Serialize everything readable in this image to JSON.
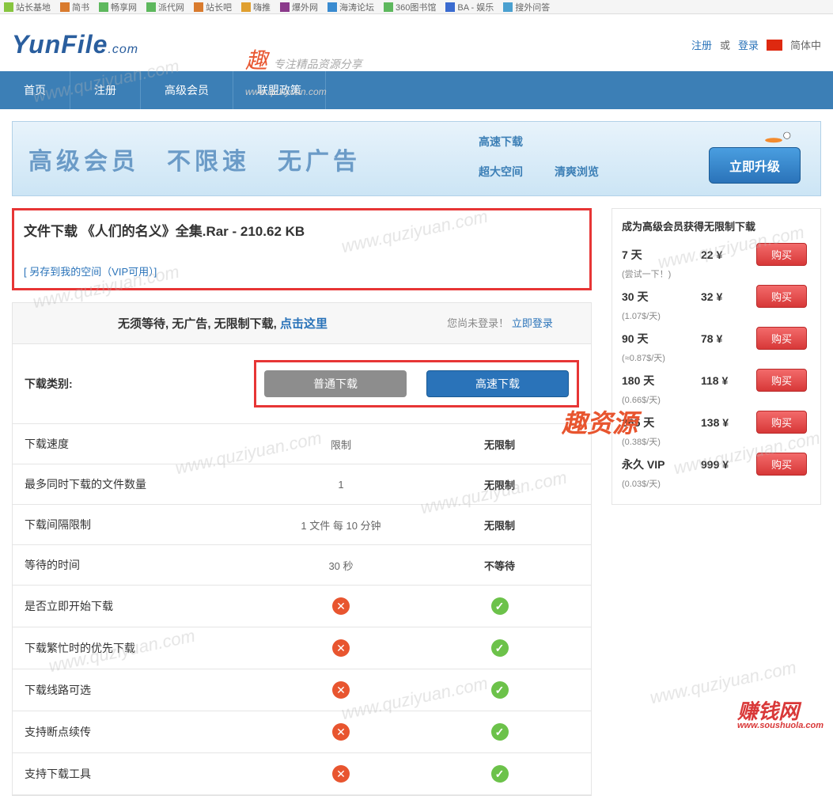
{
  "topbar": [
    "站长基地",
    "简书",
    "畅享网",
    "派代网",
    "站长吧",
    "嗨推",
    "爆外网",
    "海涛论坛",
    "360图书馆",
    "BA - 娱乐",
    "搜外问答"
  ],
  "logo": {
    "main": "YunFile",
    "ext": ".com"
  },
  "headerLinks": {
    "register": "注册",
    "or": "或",
    "login": "登录",
    "lang": "简体中"
  },
  "nav": [
    "首页",
    "注册",
    "高级会员",
    "联盟政策"
  ],
  "banner": {
    "text": "高级会员　不限速　无广告",
    "links": {
      "r1a": "高速下载",
      "r2a": "超大空间",
      "r2b": "清爽浏览"
    },
    "upgrade": "立即升级"
  },
  "fileBox": {
    "title": "文件下载 《人们的名义》全集.Rar - 210.62 KB",
    "save": "[ 另存到我的空间（VIP可用）]"
  },
  "compareHead": {
    "left_prefix": "无须等待, 无广告, 无限制下载, ",
    "left_link": "点击这里",
    "right_prefix": "您尚未登录！",
    "right_link": "立即登录"
  },
  "btnRow": {
    "label": "下载类别:",
    "normal": "普通下载",
    "fast": "高速下载"
  },
  "rows": [
    {
      "label": "下载速度",
      "c2": "限制",
      "c3": "无限制",
      "type": "text"
    },
    {
      "label": "最多同时下载的文件数量",
      "c2": "1",
      "c3": "无限制",
      "type": "text"
    },
    {
      "label": "下载间隔限制",
      "c2": "1 文件 每 10 分钟",
      "c3": "无限制",
      "type": "text"
    },
    {
      "label": "等待的时间",
      "c2": "30 秒",
      "c3": "不等待",
      "type": "text"
    },
    {
      "label": "是否立即开始下载",
      "type": "icon"
    },
    {
      "label": "下载繁忙时的优先下载",
      "type": "icon"
    },
    {
      "label": "下载线路可选",
      "type": "icon"
    },
    {
      "label": "支持断点续传",
      "type": "icon"
    },
    {
      "label": "支持下载工具",
      "type": "icon"
    }
  ],
  "vip": {
    "title": "成为高级会员获得无限制下载",
    "buy": "购买",
    "plans": [
      {
        "period": "7 天",
        "price": "22 ¥",
        "sub": "(尝试一下！)"
      },
      {
        "period": "30 天",
        "price": "32 ¥",
        "sub": "(1.07$/天)"
      },
      {
        "period": "90 天",
        "price": "78 ¥",
        "sub": "(≈0.87$/天)"
      },
      {
        "period": "180 天",
        "price": "118 ¥",
        "sub": "(0.66$/天)"
      },
      {
        "period": "365 天",
        "price": "138 ¥",
        "sub": "(0.38$/天)"
      },
      {
        "period": "永久 VIP",
        "price": "999 ¥",
        "sub": "(0.03$/天)"
      }
    ]
  },
  "watermarks": {
    "url": "www.quziyuan.com",
    "tagline": "专注精品资源分享",
    "side": "趣资源",
    "earn": "赚钱网",
    "earn_sub": "www.soushuola.com"
  }
}
